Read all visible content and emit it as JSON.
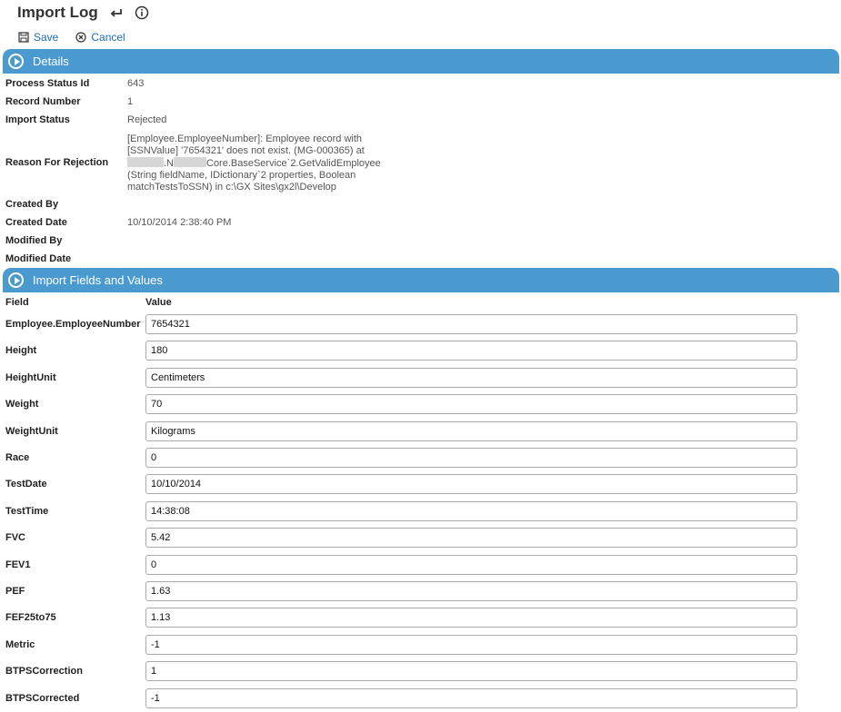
{
  "header": {
    "title": "Import Log",
    "icons": [
      "return-icon",
      "info-icon"
    ]
  },
  "toolbar": {
    "save_label": "Save",
    "cancel_label": "Cancel"
  },
  "details": {
    "section_title": "Details",
    "process_status_id": {
      "label": "Process Status Id",
      "value": "643"
    },
    "record_number": {
      "label": "Record Number",
      "value": "1"
    },
    "import_status": {
      "label": "Import Status",
      "value": "Rejected"
    },
    "reason": {
      "label": "Reason For Rejection",
      "line1": "[Employee.EmployeeNumber]: Employee record with",
      "line2": "[SSNValue] '7654321' does not exist. (MG-000365) at",
      "line3_a": ".N",
      "line3_b": "Core.BaseService`2.GetValidEmployee",
      "line4": "(String fieldName, IDictionary`2 properties, Boolean",
      "line5": "matchTestsToSSN) in c:\\GX Sites\\gx2l\\Develop"
    },
    "created_by": {
      "label": "Created By",
      "value": ""
    },
    "created_date": {
      "label": "Created Date",
      "value": "10/10/2014 2:38:40 PM"
    },
    "modified_by": {
      "label": "Modified By",
      "value": ""
    },
    "modified_date": {
      "label": "Modified Date",
      "value": ""
    }
  },
  "fields": {
    "section_title": "Import Fields and Values",
    "col_field": "Field",
    "col_value": "Value",
    "rows": [
      {
        "field": "Employee.EmployeeNumber",
        "value": "7654321"
      },
      {
        "field": "Height",
        "value": "180"
      },
      {
        "field": "HeightUnit",
        "value": "Centimeters"
      },
      {
        "field": "Weight",
        "value": "70"
      },
      {
        "field": "WeightUnit",
        "value": "Kilograms"
      },
      {
        "field": "Race",
        "value": "0"
      },
      {
        "field": "TestDate",
        "value": "10/10/2014"
      },
      {
        "field": "TestTime",
        "value": "14:38:08"
      },
      {
        "field": "FVC",
        "value": "5.42"
      },
      {
        "field": "FEV1",
        "value": "0"
      },
      {
        "field": "PEF",
        "value": "1.63"
      },
      {
        "field": "FEF25to75",
        "value": "1.13"
      },
      {
        "field": "Metric",
        "value": "-1"
      },
      {
        "field": "BTPSCorrection",
        "value": "1"
      },
      {
        "field": "BTPSCorrected",
        "value": "-1"
      }
    ]
  },
  "colors": {
    "section_bar": "#4a9ad0",
    "link": "#1c6fb8"
  }
}
